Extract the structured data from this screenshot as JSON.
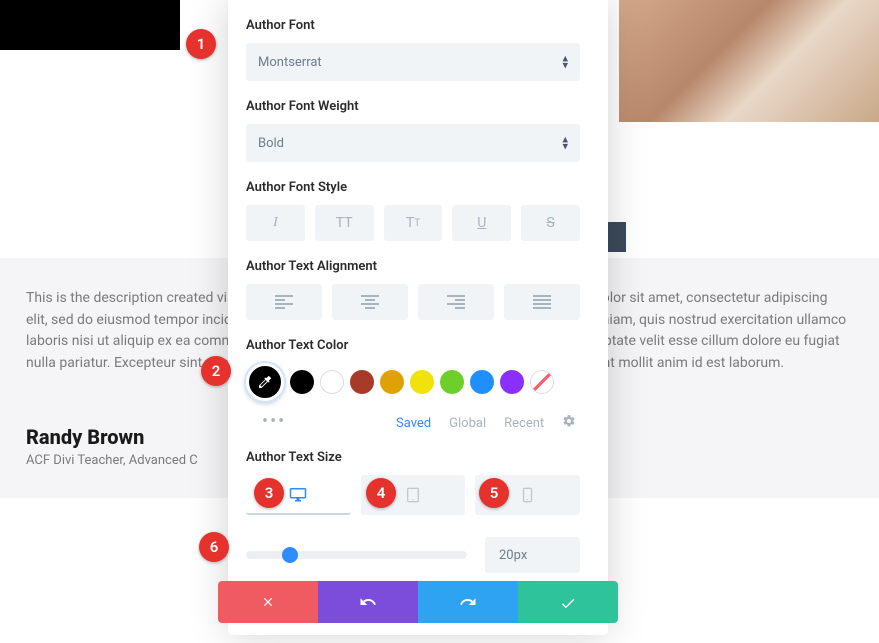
{
  "testimonial": {
    "text": "This is the description created via ACF for the Testimonial Custom Post Type. Lorem ipsum dolor sit amet, consectetur adipiscing elit, sed do eiusmod tempor incididunt ut labore et dolore magna aliqua. Ut enim ad minim veniam, quis nostrud exercitation ullamco laboris nisi ut aliquip ex ea commodo consequat. Duis aute irure dolor in reprehenderit in voluptate velit esse cillum dolore eu fugiat nulla pariatur. Excepteur sint occaecat cupidatat non proident, sunt in culpa qui officia deserunt mollit anim id est laborum.",
    "author": "Randy Brown",
    "role": "ACF Divi Teacher, Advanced C"
  },
  "panel": {
    "author_font": {
      "label": "Author Font",
      "value": "Montserrat"
    },
    "author_font_weight": {
      "label": "Author Font Weight",
      "value": "Bold"
    },
    "author_font_style": {
      "label": "Author Font Style"
    },
    "author_text_alignment": {
      "label": "Author Text Alignment"
    },
    "author_text_color": {
      "label": "Author Text Color",
      "colors": [
        "#000000",
        "#FFFFFF",
        "#a83a2a",
        "#e0a106",
        "#f0e20a",
        "#6fcf2a",
        "#1f8fff",
        "#8b2fff"
      ],
      "tabs": {
        "saved": "Saved",
        "global": "Global",
        "recent": "Recent"
      },
      "dots": "•••"
    },
    "author_text_size": {
      "label": "Author Text Size",
      "value": "20px",
      "slider_percent": 20
    }
  },
  "markers": {
    "1": "1",
    "2": "2",
    "3": "3",
    "4": "4",
    "5": "5",
    "6": "6"
  }
}
